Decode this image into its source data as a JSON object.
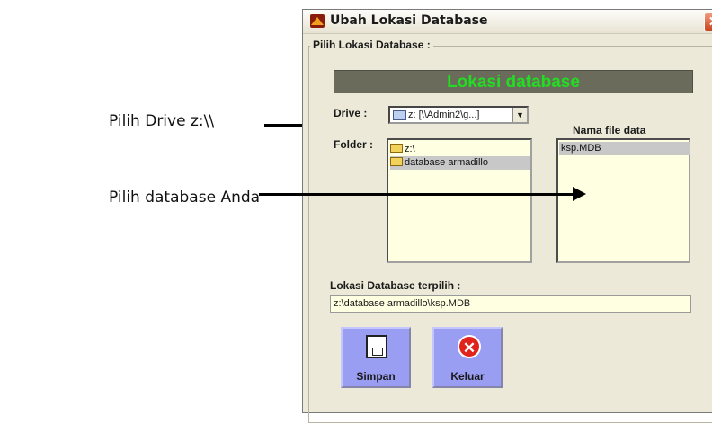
{
  "annotations": {
    "drive_hint": "Pilih Drive z:\\\\",
    "database_hint": "Pilih database Anda"
  },
  "window": {
    "title": "Ubah Lokasi Database",
    "close_glyph": "✕"
  },
  "groupbox": {
    "label": "Pilih Lokasi Database :"
  },
  "banner": {
    "text": "Lokasi database",
    "text_color": "#22dd22",
    "bg_color": "#6b6b5b"
  },
  "drive": {
    "label": "Drive :",
    "value": "z: [\\\\Admin2\\g...]",
    "icon": "network-drive-icon"
  },
  "folder": {
    "label": "Folder :",
    "items": [
      {
        "label": "z:\\",
        "icon": "open-folder-icon",
        "selected": false
      },
      {
        "label": "database armadillo",
        "icon": "open-folder-icon",
        "selected": true
      }
    ]
  },
  "files": {
    "header": "Nama file data",
    "items": [
      {
        "label": "ksp.MDB",
        "selected": true
      }
    ]
  },
  "selected_path": {
    "label": "Lokasi Database terpilih :",
    "value": "z:\\database armadillo\\ksp.MDB"
  },
  "buttons": {
    "save_label": "Simpan",
    "exit_label": "Keluar",
    "exit_glyph": "✕"
  }
}
